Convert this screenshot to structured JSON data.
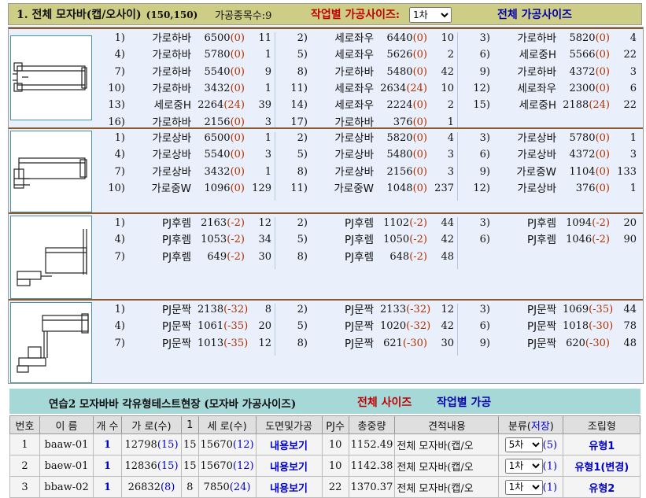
{
  "header": {
    "title": "1. 전체 모자바(캡/오사이)",
    "dims": "(150,150)",
    "item_count": "가공종목수:9",
    "work_size_label": "작업별 가공사이즈:",
    "work_select_value": "1차",
    "all_sizes_label": "전체 가공사이즈"
  },
  "groups": [
    {
      "rows": [
        [
          {
            "idx": "1)",
            "name": "가로하바",
            "len": "6500",
            "adj": "(0)",
            "qty": "11"
          },
          {
            "idx": "2)",
            "name": "세로좌우",
            "len": "6440",
            "adj": "(0)",
            "qty": "10"
          },
          {
            "idx": "3)",
            "name": "가로하바",
            "len": "5820",
            "adj": "(0)",
            "qty": "4"
          }
        ],
        [
          {
            "idx": "4)",
            "name": "가로하바",
            "len": "5780",
            "adj": "(0)",
            "qty": "1"
          },
          {
            "idx": "5)",
            "name": "세로좌우",
            "len": "5626",
            "adj": "(0)",
            "qty": "2"
          },
          {
            "idx": "6)",
            "name": "세로중H",
            "len": "5566",
            "adj": "(0)",
            "qty": "22"
          }
        ],
        [
          {
            "idx": "7)",
            "name": "가로하바",
            "len": "5540",
            "adj": "(0)",
            "qty": "9"
          },
          {
            "idx": "8)",
            "name": "가로하바",
            "len": "5480",
            "adj": "(0)",
            "qty": "42"
          },
          {
            "idx": "9)",
            "name": "가로하바",
            "len": "4372",
            "adj": "(0)",
            "qty": "3"
          }
        ],
        [
          {
            "idx": "10)",
            "name": "가로하바",
            "len": "3432",
            "adj": "(0)",
            "qty": "1"
          },
          {
            "idx": "11)",
            "name": "세로좌우",
            "len": "2634",
            "adj": "(24)",
            "qty": "10"
          },
          {
            "idx": "12)",
            "name": "세로좌우",
            "len": "2300",
            "adj": "(0)",
            "qty": "6"
          }
        ],
        [
          {
            "idx": "13)",
            "name": "세로중H",
            "len": "2264",
            "adj": "(24)",
            "qty": "39"
          },
          {
            "idx": "14)",
            "name": "세로좌우",
            "len": "2224",
            "adj": "(0)",
            "qty": "2"
          },
          {
            "idx": "15)",
            "name": "세로중H",
            "len": "2188",
            "adj": "(24)",
            "qty": "22"
          }
        ],
        [
          {
            "idx": "16)",
            "name": "가로하바",
            "len": "2156",
            "adj": "(0)",
            "qty": "3"
          },
          {
            "idx": "17)",
            "name": "가로하바",
            "len": "376",
            "adj": "(0)",
            "qty": "1"
          }
        ]
      ]
    },
    {
      "rows": [
        [
          {
            "idx": "1)",
            "name": "가로상바",
            "len": "6500",
            "adj": "(0)",
            "qty": "1"
          },
          {
            "idx": "2)",
            "name": "가로상바",
            "len": "5820",
            "adj": "(0)",
            "qty": "4"
          },
          {
            "idx": "3)",
            "name": "가로상바",
            "len": "5780",
            "adj": "(0)",
            "qty": "1"
          }
        ],
        [
          {
            "idx": "4)",
            "name": "가로상바",
            "len": "5540",
            "adj": "(0)",
            "qty": "3"
          },
          {
            "idx": "5)",
            "name": "가로상바",
            "len": "5480",
            "adj": "(0)",
            "qty": "3"
          },
          {
            "idx": "6)",
            "name": "가로상바",
            "len": "4372",
            "adj": "(0)",
            "qty": "3"
          }
        ],
        [
          {
            "idx": "7)",
            "name": "가로상바",
            "len": "3432",
            "adj": "(0)",
            "qty": "1"
          },
          {
            "idx": "8)",
            "name": "가로상바",
            "len": "2156",
            "adj": "(0)",
            "qty": "3"
          },
          {
            "idx": "9)",
            "name": "가로중W",
            "len": "1104",
            "adj": "(0)",
            "qty": "133"
          }
        ],
        [
          {
            "idx": "10)",
            "name": "가로중W",
            "len": "1096",
            "adj": "(0)",
            "qty": "129"
          },
          {
            "idx": "11)",
            "name": "가로중W",
            "len": "1048",
            "adj": "(0)",
            "qty": "237"
          },
          {
            "idx": "12)",
            "name": "가로상바",
            "len": "376",
            "adj": "(0)",
            "qty": "1"
          }
        ]
      ]
    },
    {
      "rows": [
        [
          {
            "idx": "1)",
            "name": "PJ후렘",
            "len": "2163",
            "adj": "(-2)",
            "qty": "12"
          },
          {
            "idx": "2)",
            "name": "PJ후렘",
            "len": "1102",
            "adj": "(-2)",
            "qty": "44"
          },
          {
            "idx": "3)",
            "name": "PJ후렘",
            "len": "1094",
            "adj": "(-2)",
            "qty": "20"
          }
        ],
        [
          {
            "idx": "4)",
            "name": "PJ후렘",
            "len": "1053",
            "adj": "(-2)",
            "qty": "34"
          },
          {
            "idx": "5)",
            "name": "PJ후렘",
            "len": "1050",
            "adj": "(-2)",
            "qty": "42"
          },
          {
            "idx": "6)",
            "name": "PJ후렘",
            "len": "1046",
            "adj": "(-2)",
            "qty": "90"
          }
        ],
        [
          {
            "idx": "7)",
            "name": "PJ후렘",
            "len": "649",
            "adj": "(-2)",
            "qty": "30"
          },
          {
            "idx": "8)",
            "name": "PJ후렘",
            "len": "648",
            "adj": "(-2)",
            "qty": "48"
          }
        ]
      ]
    },
    {
      "rows": [
        [
          {
            "idx": "1)",
            "name": "PJ문짝",
            "len": "2138",
            "adj": "(-32)",
            "qty": "8"
          },
          {
            "idx": "2)",
            "name": "PJ문짝",
            "len": "2133",
            "adj": "(-32)",
            "qty": "12"
          },
          {
            "idx": "3)",
            "name": "PJ문짝",
            "len": "1069",
            "adj": "(-35)",
            "qty": "44"
          }
        ],
        [
          {
            "idx": "4)",
            "name": "PJ문짝",
            "len": "1061",
            "adj": "(-35)",
            "qty": "20"
          },
          {
            "idx": "5)",
            "name": "PJ문짝",
            "len": "1020",
            "adj": "(-32)",
            "qty": "42"
          },
          {
            "idx": "6)",
            "name": "PJ문짝",
            "len": "1018",
            "adj": "(-30)",
            "qty": "78"
          }
        ],
        [
          {
            "idx": "7)",
            "name": "PJ문짝",
            "len": "1013",
            "adj": "(-35)",
            "qty": "12"
          },
          {
            "idx": "8)",
            "name": "PJ문짝",
            "len": "621",
            "adj": "(-30)",
            "qty": "30"
          },
          {
            "idx": "9)",
            "name": "PJ문짝",
            "len": "620",
            "adj": "(-30)",
            "qty": "48"
          }
        ]
      ]
    }
  ],
  "bottom": {
    "title": "연습2 모자바바 각유형테스트현장 (모자바 가공사이즈)",
    "full_size": "전체 사이즈",
    "work_process": "작업별 가공",
    "columns": {
      "no": "번호",
      "name": "이 름",
      "count": "개 수",
      "width": "가 로(수)",
      "one": "1",
      "height": "세 로(수)",
      "drawing": "도면및가공",
      "pj": "PJ수",
      "weight": "총중량",
      "estimate": "견적내용",
      "class": "분류(",
      "save": "저장",
      "class_end": ")",
      "assembly": "조립형"
    },
    "rows": [
      {
        "no": "1",
        "name": "baaw-01",
        "count": "1",
        "w": "12798",
        "wq": "(15)",
        "mid": "15",
        "h": "15670",
        "hq": "(12)",
        "view": "내용보기",
        "pj": "10",
        "weight": "1152.49",
        "estimate": "전체 모자바(캡/오",
        "sel": "5차",
        "selq": "(5)",
        "assembly": "유형1"
      },
      {
        "no": "2",
        "name": "baew-01",
        "count": "1",
        "w": "12836",
        "wq": "(15)",
        "mid": "15",
        "h": "15670",
        "hq": "(12)",
        "view": "내용보기",
        "pj": "10",
        "weight": "1142.38",
        "estimate": "전체 모자바(캡/오",
        "sel": "1차",
        "selq": "(1)",
        "assembly": "유형1(변경)"
      },
      {
        "no": "3",
        "name": "bbaw-02",
        "count": "1",
        "w": "26832",
        "wq": "(8)",
        "mid": "8",
        "h": "7850",
        "hq": "(24)",
        "view": "내용보기",
        "pj": "22",
        "weight": "1370.37",
        "estimate": "전체 모자바(캡/오",
        "sel": "1차",
        "selq": "(1)",
        "assembly": "유형2"
      }
    ]
  },
  "colors": {
    "header_bg": "#cdcd86",
    "accent_red": "#c00000",
    "accent_blue": "#0000aa",
    "panel_bg": "#eaf0fb",
    "bottom_head_bg": "#a7d8d8"
  }
}
